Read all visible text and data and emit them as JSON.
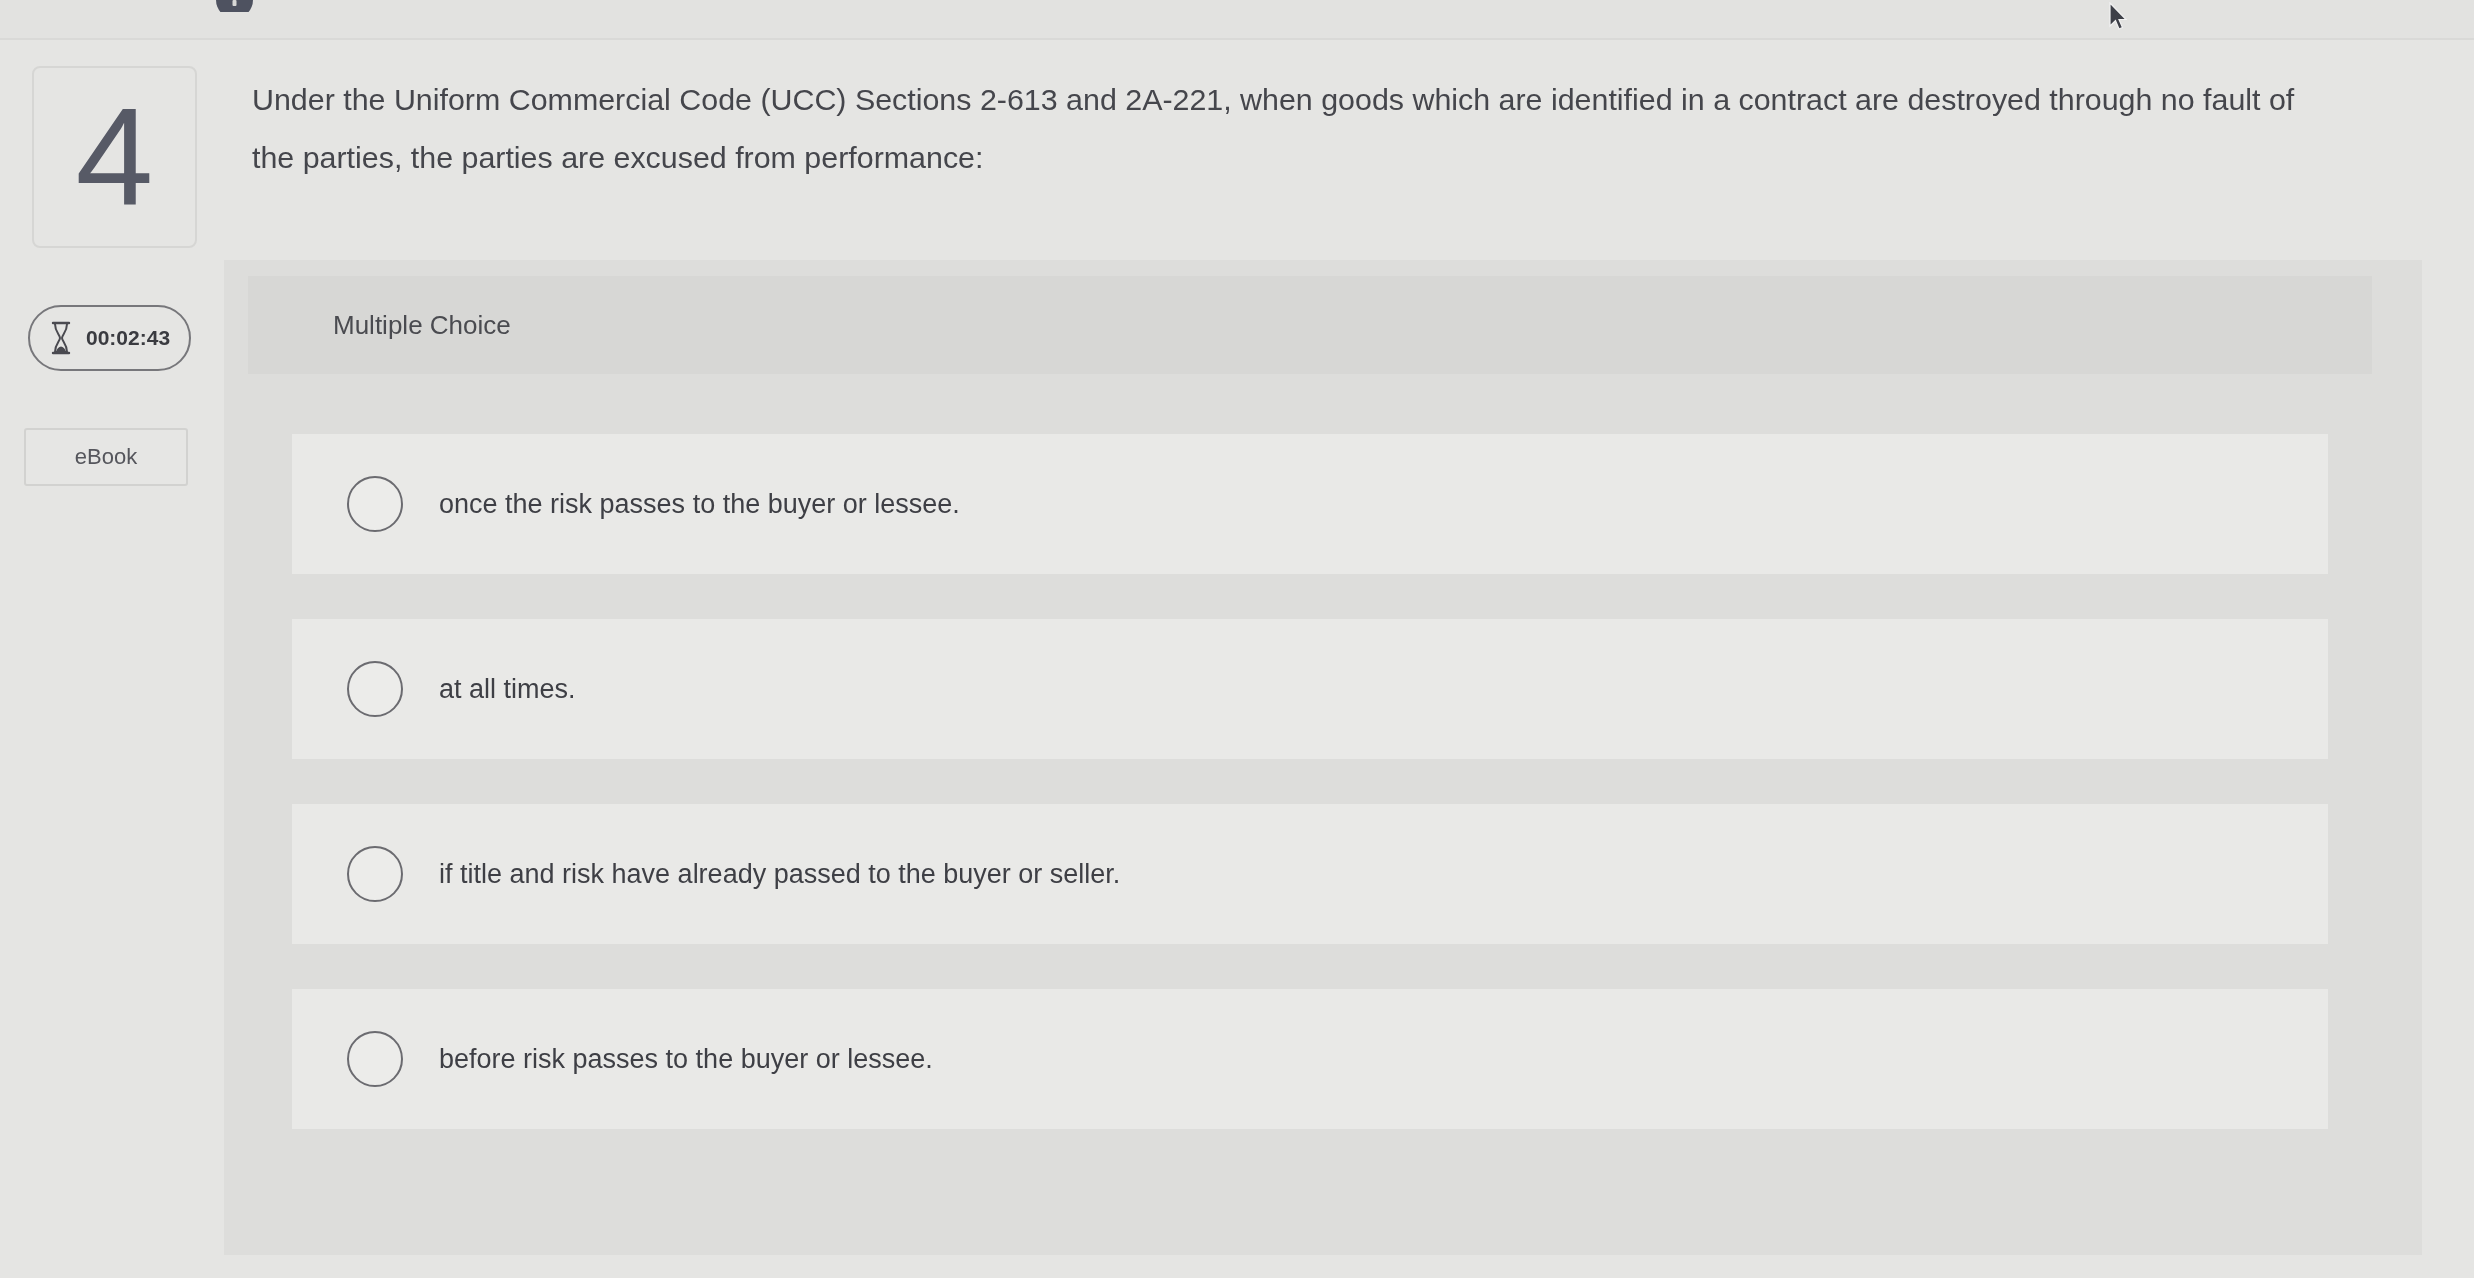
{
  "question": {
    "number": "4",
    "text": "Under the Uniform Commercial Code (UCC) Sections 2-613 and 2A-221, when goods which are identified in a contract are destroyed through no fault of the parties, the parties are excused from performance:"
  },
  "timer": {
    "time": "00:02:43"
  },
  "ebook": {
    "label": "eBook"
  },
  "answer_panel": {
    "heading": "Multiple Choice",
    "options": [
      {
        "text": "once the risk passes to the buyer or lessee.",
        "selected": false
      },
      {
        "text": "at all times.",
        "selected": false
      },
      {
        "text": "if title and risk have already passed to the buyer or seller.",
        "selected": false
      },
      {
        "text": "before risk passes to the buyer or lessee.",
        "selected": false
      }
    ]
  }
}
